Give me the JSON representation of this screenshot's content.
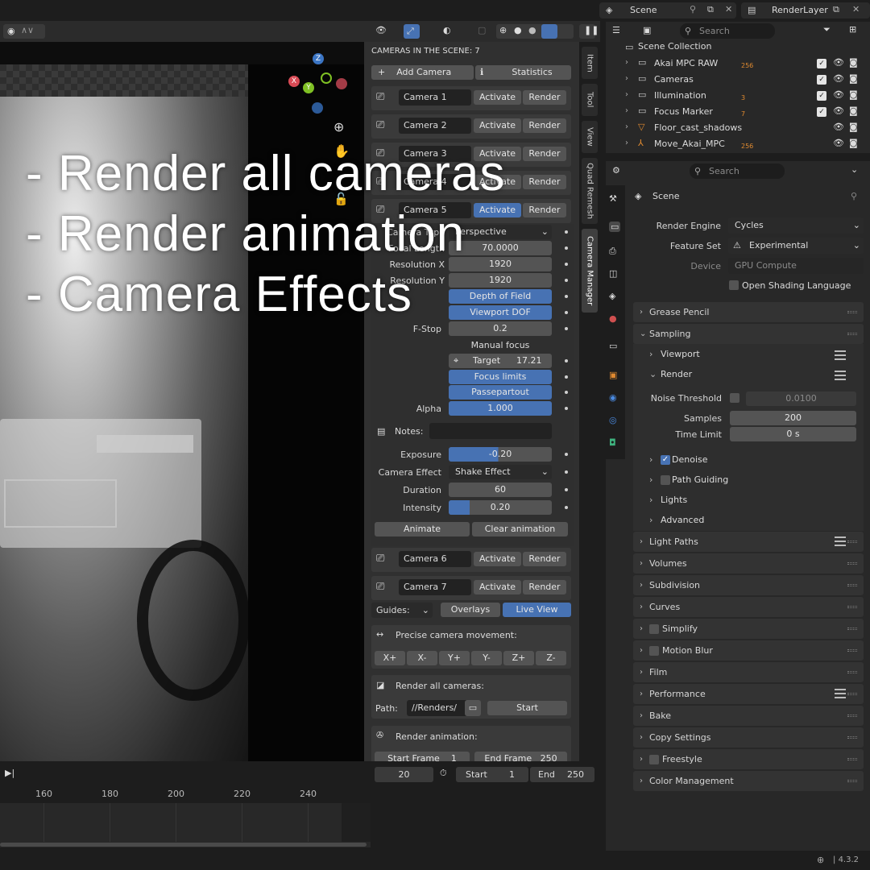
{
  "topbar": {
    "scene_name": "Scene",
    "view_layer": "RenderLayer"
  },
  "overlay": {
    "lines": [
      "- Render all cameras",
      "- Render animation",
      "- Camera Effects"
    ]
  },
  "camera_manager": {
    "header": "CAMERAS IN THE SCENE: 7",
    "add_camera": "Add Camera",
    "statistics": "Statistics",
    "activate": "Activate",
    "render": "Render",
    "cameras": [
      "Camera 1",
      "Camera 2",
      "Camera 3",
      "Camera 4",
      "Camera 5",
      "Camera 6",
      "Camera 7"
    ],
    "camera5": {
      "type_label": "Camera Type",
      "type_value": "Perspective",
      "focal_label": "Focal Length",
      "focal_value": "70.0000",
      "resx_label": "Resolution X",
      "resx_value": "1920",
      "resy_label": "Resolution Y",
      "resy_value": "1920",
      "dof": "Depth of Field",
      "viewport_dof": "Viewport DOF",
      "fstop_label": "F-Stop",
      "fstop_value": "0.2",
      "manual_focus": "Manual focus",
      "target_label": "Target",
      "target_value": "17.21",
      "focus_limits": "Focus limits",
      "passepartout": "Passepartout",
      "alpha_label": "Alpha",
      "alpha_value": "1.000",
      "notes_label": "Notes:",
      "exposure_label": "Exposure",
      "exposure_value": "-0.20",
      "effect_label": "Camera Effect",
      "effect_value": "Shake Effect",
      "duration_label": "Duration",
      "duration_value": "60",
      "intensity_label": "Intensity",
      "intensity_value": "0.20",
      "intensity_fill": 0.2,
      "animate": "Animate",
      "clear_animation": "Clear animation"
    },
    "guides": "Guides:",
    "overlays": "Overlays",
    "live_view": "Live View",
    "precise": "Precise camera movement:",
    "moves": [
      "X+",
      "X-",
      "Y+",
      "Y-",
      "Z+",
      "Z-"
    ],
    "render_all": "Render all cameras:",
    "path_label": "Path:",
    "path_value": "//Renders/",
    "start": "Start",
    "render_anim": "Render animation:",
    "start_frame": "Start Frame",
    "start_frame_value": "1",
    "end_frame": "End Frame",
    "end_frame_value": "250"
  },
  "side_tabs": [
    "Item",
    "Tool",
    "View",
    "Quad Remesh",
    "Camera Manager"
  ],
  "outliner": {
    "search": "Search",
    "collection": "Scene Collection",
    "items": [
      {
        "name": "Akai MPC RAW",
        "badge": "256"
      },
      {
        "name": "Cameras",
        "badge": ""
      },
      {
        "name": "Illumination",
        "badge": "3"
      },
      {
        "name": "Focus Marker",
        "badge": "7"
      },
      {
        "name": "Floor_cast_shadows",
        "badge": ""
      },
      {
        "name": "Move_Akai_MPC",
        "badge": "256"
      }
    ]
  },
  "properties": {
    "search": "Search",
    "scene": "Scene",
    "render_engine_label": "Render Engine",
    "render_engine": "Cycles",
    "feature_set_label": "Feature Set",
    "feature_set": "Experimental",
    "device_label": "Device",
    "device": "GPU Compute",
    "osl": "Open Shading Language",
    "sections_top": [
      "Grease Pencil",
      "Sampling"
    ],
    "viewport": "Viewport",
    "render": "Render",
    "noise_threshold_label": "Noise Threshold",
    "noise_threshold": "0.0100",
    "samples_label": "Samples",
    "samples": "200",
    "time_limit_label": "Time Limit",
    "time_limit": "0 s",
    "denoise": "Denoise",
    "path_guiding": "Path Guiding",
    "lights": "Lights",
    "advanced": "Advanced",
    "sections": [
      "Light Paths",
      "Volumes",
      "Subdivision",
      "Curves",
      "Simplify",
      "Motion Blur",
      "Film",
      "Performance",
      "Bake",
      "Copy Settings",
      "Freestyle",
      "Color Management"
    ]
  },
  "timeline": {
    "current": "20",
    "start_label": "Start",
    "start": "1",
    "end_label": "End",
    "end": "250",
    "ticks": [
      "160",
      "180",
      "200",
      "220",
      "240"
    ]
  },
  "status": {
    "version": "4.3.2"
  }
}
